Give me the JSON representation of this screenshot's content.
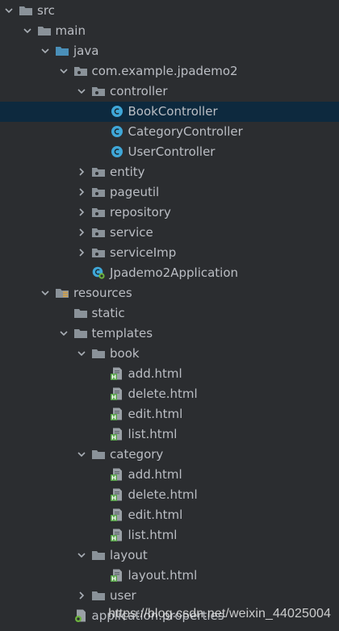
{
  "project_tree": {
    "items": [
      {
        "label": "src",
        "level": 0,
        "expander": "expanded",
        "icon": "folder-icon",
        "selected": false
      },
      {
        "label": "main",
        "level": 1,
        "expander": "expanded",
        "icon": "folder-icon",
        "selected": false
      },
      {
        "label": "java",
        "level": 2,
        "expander": "expanded",
        "icon": "source-folder-icon",
        "selected": false
      },
      {
        "label": "com.example.jpademo2",
        "level": 3,
        "expander": "expanded",
        "icon": "package-icon",
        "selected": false
      },
      {
        "label": "controller",
        "level": 4,
        "expander": "expanded",
        "icon": "package-icon",
        "selected": false
      },
      {
        "label": "BookController",
        "level": 5,
        "expander": "none",
        "icon": "java-class-icon",
        "selected": true
      },
      {
        "label": "CategoryController",
        "level": 5,
        "expander": "none",
        "icon": "java-class-icon",
        "selected": false
      },
      {
        "label": "UserController",
        "level": 5,
        "expander": "none",
        "icon": "java-class-icon",
        "selected": false
      },
      {
        "label": "entity",
        "level": 4,
        "expander": "collapsed",
        "icon": "package-icon",
        "selected": false
      },
      {
        "label": "pageutil",
        "level": 4,
        "expander": "collapsed",
        "icon": "package-icon",
        "selected": false
      },
      {
        "label": "repository",
        "level": 4,
        "expander": "collapsed",
        "icon": "package-icon",
        "selected": false
      },
      {
        "label": "service",
        "level": 4,
        "expander": "collapsed",
        "icon": "package-icon",
        "selected": false
      },
      {
        "label": "serviceImp",
        "level": 4,
        "expander": "collapsed",
        "icon": "package-icon",
        "selected": false
      },
      {
        "label": "Jpademo2Application",
        "level": 4,
        "expander": "none",
        "icon": "spring-boot-app-icon",
        "selected": false
      },
      {
        "label": "resources",
        "level": 2,
        "expander": "expanded",
        "icon": "resources-folder-icon",
        "selected": false
      },
      {
        "label": "static",
        "level": 3,
        "expander": "none",
        "icon": "folder-icon",
        "selected": false
      },
      {
        "label": "templates",
        "level": 3,
        "expander": "expanded",
        "icon": "folder-icon",
        "selected": false
      },
      {
        "label": "book",
        "level": 4,
        "expander": "expanded",
        "icon": "folder-icon",
        "selected": false
      },
      {
        "label": "add.html",
        "level": 5,
        "expander": "none",
        "icon": "html-file-icon",
        "selected": false
      },
      {
        "label": "delete.html",
        "level": 5,
        "expander": "none",
        "icon": "html-file-icon",
        "selected": false
      },
      {
        "label": "edit.html",
        "level": 5,
        "expander": "none",
        "icon": "html-file-icon",
        "selected": false
      },
      {
        "label": "list.html",
        "level": 5,
        "expander": "none",
        "icon": "html-file-icon",
        "selected": false
      },
      {
        "label": "category",
        "level": 4,
        "expander": "expanded",
        "icon": "folder-icon",
        "selected": false
      },
      {
        "label": "add.html",
        "level": 5,
        "expander": "none",
        "icon": "html-file-icon",
        "selected": false
      },
      {
        "label": "delete.html",
        "level": 5,
        "expander": "none",
        "icon": "html-file-icon",
        "selected": false
      },
      {
        "label": "edit.html",
        "level": 5,
        "expander": "none",
        "icon": "html-file-icon",
        "selected": false
      },
      {
        "label": "list.html",
        "level": 5,
        "expander": "none",
        "icon": "html-file-icon",
        "selected": false
      },
      {
        "label": "layout",
        "level": 4,
        "expander": "expanded",
        "icon": "folder-icon",
        "selected": false
      },
      {
        "label": "layout.html",
        "level": 5,
        "expander": "none",
        "icon": "html-file-icon",
        "selected": false
      },
      {
        "label": "user",
        "level": 4,
        "expander": "collapsed",
        "icon": "folder-icon",
        "selected": false
      },
      {
        "label": "application.properties",
        "level": 3,
        "expander": "none",
        "icon": "properties-file-icon",
        "selected": false
      }
    ]
  },
  "watermark": {
    "text": "https://blog.csdn.net/weixin_44025004"
  },
  "colors": {
    "background": "#2b2d30",
    "text": "#bbbec4",
    "selection": "#0d293e",
    "folder": "#8a9299",
    "source_folder": "#4a8fb8",
    "java_class": "#3fa7d8",
    "html_green": "#58a34a"
  }
}
